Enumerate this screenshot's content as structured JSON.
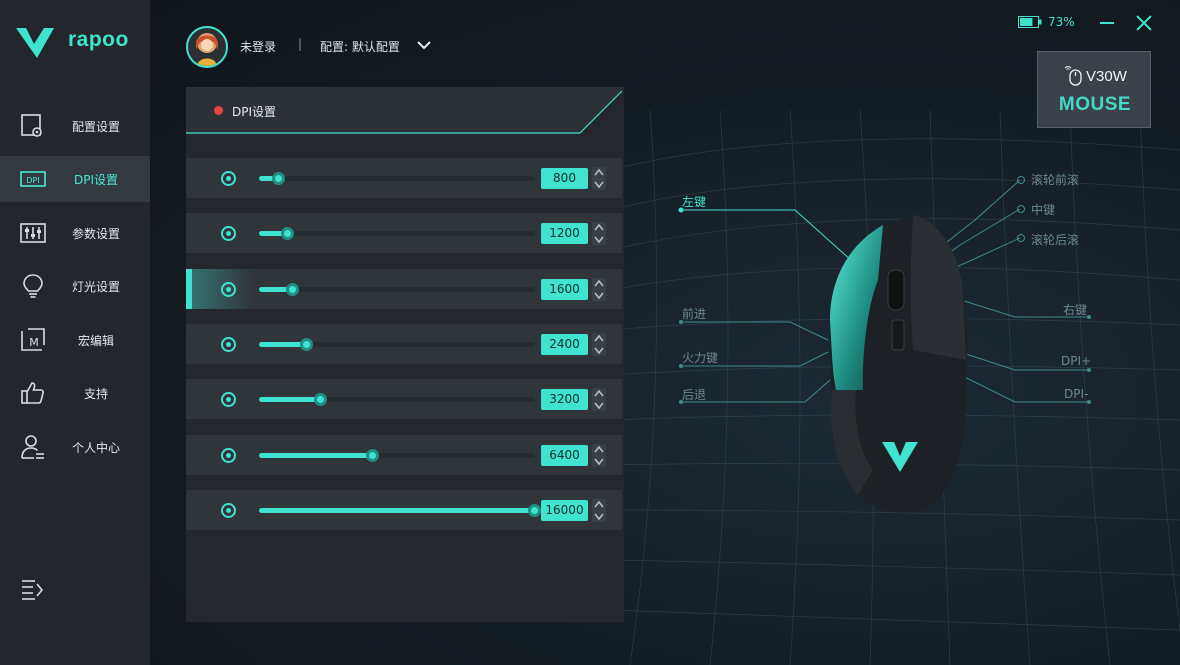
{
  "brand": {
    "logo_text": "rapoo",
    "accent": "#3fe3cf"
  },
  "sidebar": {
    "items": [
      {
        "label": "配置设置",
        "icon": "profile-settings-icon",
        "active": false
      },
      {
        "label": "DPI设置",
        "icon": "dpi-icon",
        "active": true
      },
      {
        "label": "参数设置",
        "icon": "sliders-icon",
        "active": false
      },
      {
        "label": "灯光设置",
        "icon": "lightbulb-icon",
        "active": false
      },
      {
        "label": "宏编辑",
        "icon": "macro-icon",
        "active": false
      },
      {
        "label": "支持",
        "icon": "thumbs-up-icon",
        "active": false
      },
      {
        "label": "个人中心",
        "icon": "user-icon",
        "active": false
      }
    ],
    "dpi_icon_text": "DPI",
    "macro_icon_text": "M"
  },
  "header": {
    "user_status": "未登录",
    "separator": "|",
    "config_label": "配置: 默认配置",
    "battery": "73%",
    "battery_level": 0.73
  },
  "device": {
    "model": "V30W",
    "type": "MOUSE"
  },
  "dpi_panel": {
    "title": "DPI设置",
    "max_dpi": 16000,
    "levels": [
      {
        "value": "800",
        "fraction": 0.07,
        "selected": false
      },
      {
        "value": "1200",
        "fraction": 0.1,
        "selected": false
      },
      {
        "value": "1600",
        "fraction": 0.12,
        "selected": true
      },
      {
        "value": "2400",
        "fraction": 0.17,
        "selected": false
      },
      {
        "value": "3200",
        "fraction": 0.22,
        "selected": false
      },
      {
        "value": "6400",
        "fraction": 0.41,
        "selected": false
      },
      {
        "value": "16000",
        "fraction": 0.995,
        "selected": false
      }
    ]
  },
  "mouse_buttons": {
    "left": "左键",
    "forward": "前进",
    "fire": "火力键",
    "back": "后退",
    "scroll_up": "滚轮前滚",
    "middle": "中键",
    "scroll_down": "滚轮后滚",
    "right": "右键",
    "dpi_plus": "DPI+",
    "dpi_minus": "DPI-"
  }
}
